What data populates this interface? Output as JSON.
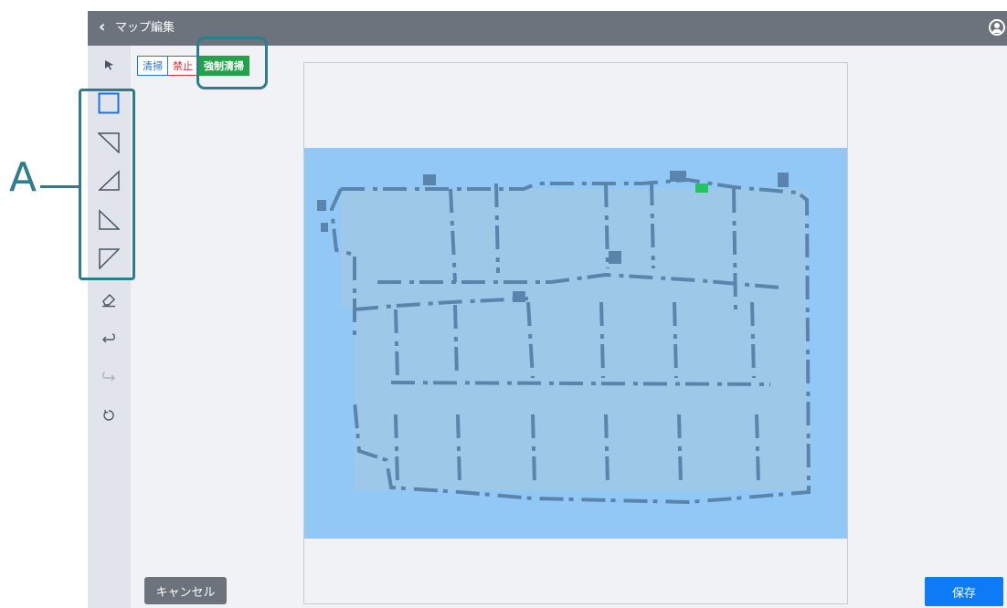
{
  "header": {
    "back_glyph": "‹",
    "title": "マップ編集",
    "account_icon": "user-circle-icon"
  },
  "toolbar": {
    "tools": [
      {
        "name": "select-tool",
        "icon": "arrow-cursor-icon"
      },
      {
        "name": "rectangle-tool",
        "icon": "square-icon",
        "active": true
      },
      {
        "name": "triangle-tool-top-right",
        "icon": "triangle-top-right-icon"
      },
      {
        "name": "triangle-tool-bottom-right",
        "icon": "triangle-bottom-right-icon"
      },
      {
        "name": "triangle-tool-bottom-left",
        "icon": "triangle-bottom-left-icon"
      },
      {
        "name": "triangle-tool-top-left",
        "icon": "triangle-top-left-icon"
      },
      {
        "name": "eraser-tool",
        "icon": "eraser-icon"
      },
      {
        "name": "undo-tool",
        "icon": "undo-icon"
      },
      {
        "name": "redo-tool",
        "icon": "redo-icon",
        "disabled": true
      },
      {
        "name": "reset-tool",
        "icon": "reset-icon"
      }
    ]
  },
  "modes": {
    "clean": "清掃",
    "forbid": "禁止",
    "force": "強制清掃"
  },
  "footer": {
    "cancel": "キャンセル",
    "save": "保存"
  },
  "annotation": {
    "label": "A"
  },
  "colors": {
    "header": "#6c737c",
    "accent": "#1a73e8",
    "forbid": "#d9303c",
    "force": "#22a24a",
    "save": "#0d7bf5",
    "annotation": "#2e7d8c",
    "map_fill": "#92c8f6",
    "map_floor": "#9ec8e8",
    "map_wall": "#5b84ad",
    "map_dock": "#22c55e"
  }
}
